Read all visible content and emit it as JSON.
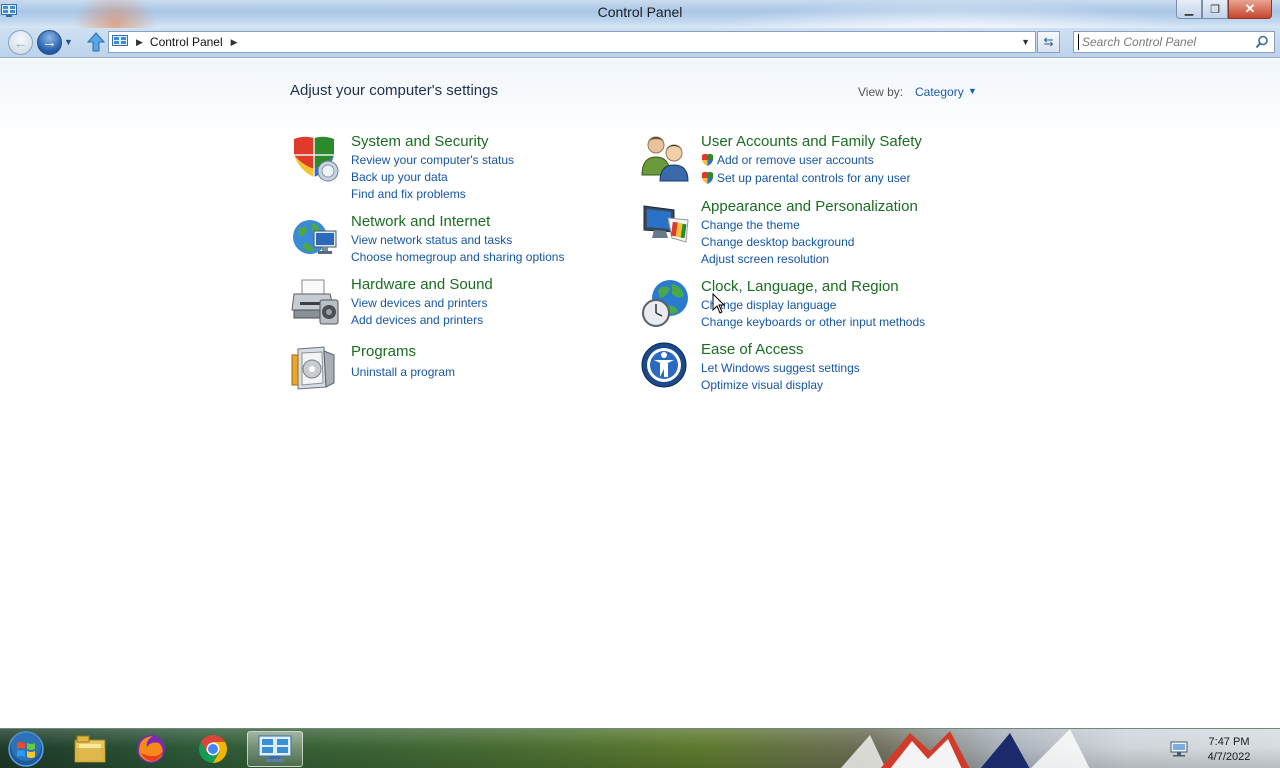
{
  "window": {
    "title": "Control Panel",
    "minimize_label": "▁",
    "restore_label": "❐",
    "close_label": "✕"
  },
  "navbar": {
    "breadcrumb": "Control Panel",
    "search_placeholder": "Search Control Panel"
  },
  "main": {
    "heading": "Adjust your computer's settings",
    "view_by_label": "View by:",
    "view_by_value": "Category"
  },
  "categories": [
    {
      "title": "System and Security",
      "icon": "shield-icon",
      "links": [
        "Review your computer's status",
        "Back up your data",
        "Find and fix problems"
      ]
    },
    {
      "title": "Network and Internet",
      "icon": "globe-network-icon",
      "links": [
        "View network status and tasks",
        "Choose homegroup and sharing options"
      ]
    },
    {
      "title": "Hardware and Sound",
      "icon": "printer-icon",
      "links": [
        "View devices and printers",
        "Add devices and printers"
      ]
    },
    {
      "title": "Programs",
      "icon": "programs-icon",
      "links": [
        "Uninstall a program"
      ]
    },
    {
      "title": "User Accounts and Family Safety",
      "icon": "users-icon",
      "links": [
        "Add or remove user accounts",
        "Set up parental controls for any user"
      ]
    },
    {
      "title": "Appearance and Personalization",
      "icon": "monitor-palette-icon",
      "links": [
        "Change the theme",
        "Change desktop background",
        "Adjust screen resolution"
      ]
    },
    {
      "title": "Clock, Language, and Region",
      "icon": "clock-globe-icon",
      "links": [
        "Change display language",
        "Change keyboards or other input methods"
      ]
    },
    {
      "title": "Ease of Access",
      "icon": "ease-of-access-icon",
      "links": [
        "Let Windows suggest settings",
        "Optimize visual display"
      ]
    }
  ],
  "taskbar": {
    "items": [
      "start-button",
      "file-explorer-icon",
      "firefox-icon",
      "chrome-icon",
      "control-panel-icon"
    ],
    "clock_time": "7:47 PM",
    "clock_date": "4/7/2022"
  },
  "colors": {
    "category_title": "#1a6d21",
    "link": "#1656a8",
    "heading": "#1e3050"
  }
}
